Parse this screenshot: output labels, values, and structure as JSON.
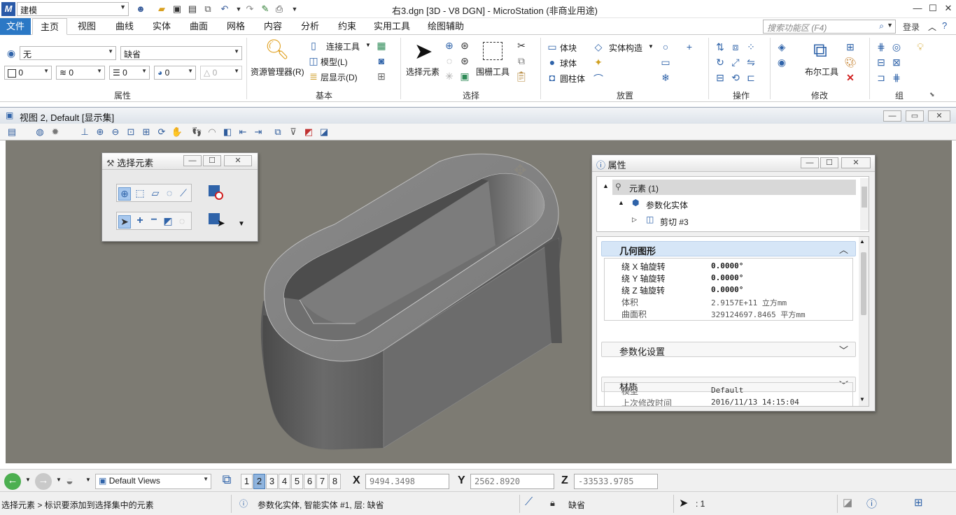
{
  "titlebar": {
    "workspace": "建模",
    "title": "右3.dgn [3D - V8 DGN] - MicroStation (非商业用途)"
  },
  "tabs": [
    "文件",
    "主页",
    "视图",
    "曲线",
    "实体",
    "曲面",
    "网格",
    "内容",
    "分析",
    "约束",
    "实用工具",
    "绘图辅助"
  ],
  "search": {
    "placeholder": "搜索功能区 (F4)"
  },
  "login": "登录",
  "ribbon": {
    "attr": {
      "level": "无",
      "style": "缺省",
      "color": "0",
      "linestyle": "0",
      "weight": "0",
      "transparency": "0",
      "priority": "0",
      "group": "属性"
    },
    "basic": {
      "explorer": "资源管理器(R)",
      "attach": "连接工具",
      "model": "模型(L)",
      "levels": "层显示(D)",
      "group": "基本"
    },
    "select": {
      "select_element": "选择元素",
      "fence": "围栅工具",
      "group": "选择"
    },
    "place": {
      "block": "体块",
      "sphere": "球体",
      "cylinder": "圆柱体",
      "solid_construct": "实体构造",
      "group": "放置"
    },
    "ops": {
      "group": "操作"
    },
    "modify": {
      "boolean": "布尔工具",
      "group": "修改"
    },
    "groups": {
      "group": "组"
    }
  },
  "view": {
    "title": "视图 2, Default [显示集]"
  },
  "select_dialog": {
    "title": "选择元素"
  },
  "props_dialog": {
    "title": "属性",
    "tree": {
      "root": "元素 (1)",
      "child": "参数化实体",
      "grandchild": "剪切 #3"
    },
    "geometry": {
      "header": "几何图形",
      "rows": [
        {
          "k": "绕 X 轴旋转",
          "v": "0.0000°"
        },
        {
          "k": "绕 Y 轴旋转",
          "v": "0.0000°"
        },
        {
          "k": "绕 Z 轴旋转",
          "v": "0.0000°"
        },
        {
          "k": "体积",
          "v": "2.9157E+11 立方mm"
        },
        {
          "k": "曲面积",
          "v": "329124697.8465 平方mm"
        }
      ]
    },
    "param_settings": "参数化设置",
    "material": "材质",
    "extension": {
      "header": "扩展",
      "rows": [
        {
          "k": "模型",
          "v": "Default"
        },
        {
          "k": "上次修改时间",
          "v": "2016/11/13 14:15:04"
        }
      ]
    }
  },
  "bottom": {
    "views_combo": "Default Views",
    "view_numbers": [
      "1",
      "2",
      "3",
      "4",
      "5",
      "6",
      "7",
      "8"
    ],
    "x_label": "X",
    "x": "9494.3498",
    "y_label": "Y",
    "y": "2562.8920",
    "z_label": "Z",
    "z": "-33533.9785"
  },
  "status": {
    "left": "选择元素 > 标识要添加到选择集中的元素",
    "mid": "参数化实体, 智能实体 #1, 层: 缺省",
    "level": "缺省",
    "count": ": 1"
  },
  "colors": {
    "accent": "#2b78c5",
    "viewport": "#7d7b73",
    "section_open": "#d6e6f7"
  }
}
